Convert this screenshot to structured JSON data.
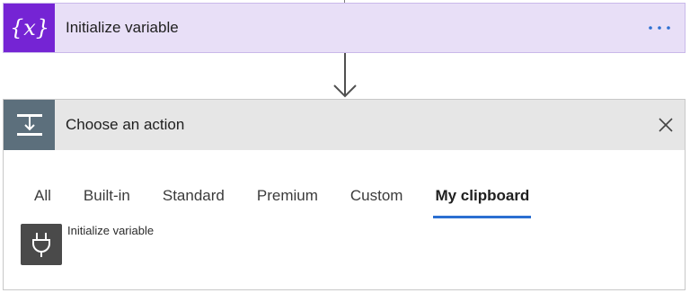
{
  "trigger_card": {
    "title": "Initialize variable",
    "icon": "variable-icon",
    "color": "#7524d4",
    "more_label": "···"
  },
  "connector": {
    "icon": "arrow-down-icon"
  },
  "action_card": {
    "title": "Choose an action",
    "icon": "action-icon",
    "close_icon": "close-icon",
    "tabs": [
      {
        "label": "All",
        "active": false
      },
      {
        "label": "Built-in",
        "active": false
      },
      {
        "label": "Standard",
        "active": false
      },
      {
        "label": "Premium",
        "active": false
      },
      {
        "label": "Custom",
        "active": false
      },
      {
        "label": "My clipboard",
        "active": true
      }
    ],
    "results": [
      {
        "label": "Initialize variable",
        "icon": "plug-icon"
      }
    ]
  },
  "colors": {
    "accent": "#2b6fd1",
    "variable_purple": "#7524d4",
    "action_gray": "#5c6f7c"
  }
}
